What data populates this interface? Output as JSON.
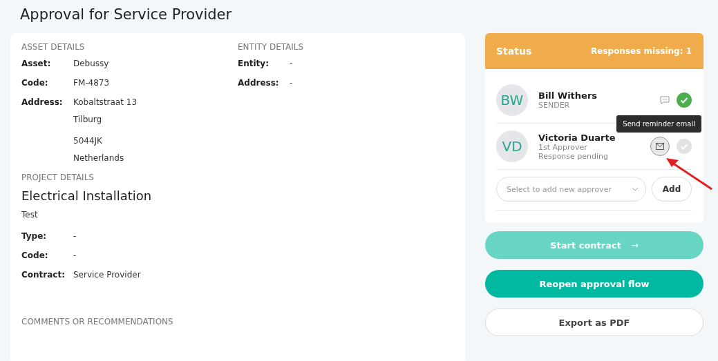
{
  "title": "Approval for Service Provider",
  "asset_details": {
    "heading": "ASSET DETAILS",
    "fields": [
      {
        "label": "Asset:",
        "lines": [
          "Debussy"
        ]
      },
      {
        "label": "Code:",
        "lines": [
          "FM-4873"
        ]
      },
      {
        "label": "Address:",
        "lines": [
          "Kobaltstraat 13",
          "Tilburg",
          "5044JK",
          "Netherlands"
        ]
      }
    ]
  },
  "entity_details": {
    "heading": "ENTITY DETAILS",
    "fields": [
      {
        "label": "Entity:",
        "lines": [
          "-"
        ]
      },
      {
        "label": "Address:",
        "lines": [
          "-"
        ]
      }
    ]
  },
  "project_details": {
    "heading": "PROJECT DETAILS",
    "name": "Electrical Installation",
    "description": "Test",
    "fields": [
      {
        "label": "Type:",
        "lines": [
          "-"
        ]
      },
      {
        "label": "Code:",
        "lines": [
          "-"
        ]
      },
      {
        "label": "Contract:",
        "lines": [
          "Service Provider"
        ]
      }
    ]
  },
  "comments_heading": "COMMENTS OR RECOMMENDATIONS",
  "status": {
    "title": "Status",
    "missing": "Responses missing: 1",
    "approvers": [
      {
        "initials": "BW",
        "name": "Bill Withers",
        "role": "SENDER",
        "kind": "comment",
        "approved": true
      },
      {
        "initials": "VD",
        "name": "Victoria Duarte",
        "role": "1st Approver",
        "note": "Response pending",
        "kind": "mail",
        "approved": false,
        "tooltip": "Send reminder email"
      }
    ],
    "select_placeholder": "Select to add new approver",
    "add_button": "Add"
  },
  "buttons": [
    {
      "label": "Start contract",
      "arrow": "→",
      "kind": "primary",
      "disabled": true
    },
    {
      "label": "Reopen approval flow",
      "kind": "primary",
      "disabled": false
    },
    {
      "label": "Export as PDF",
      "kind": "outline",
      "disabled": false
    }
  ]
}
